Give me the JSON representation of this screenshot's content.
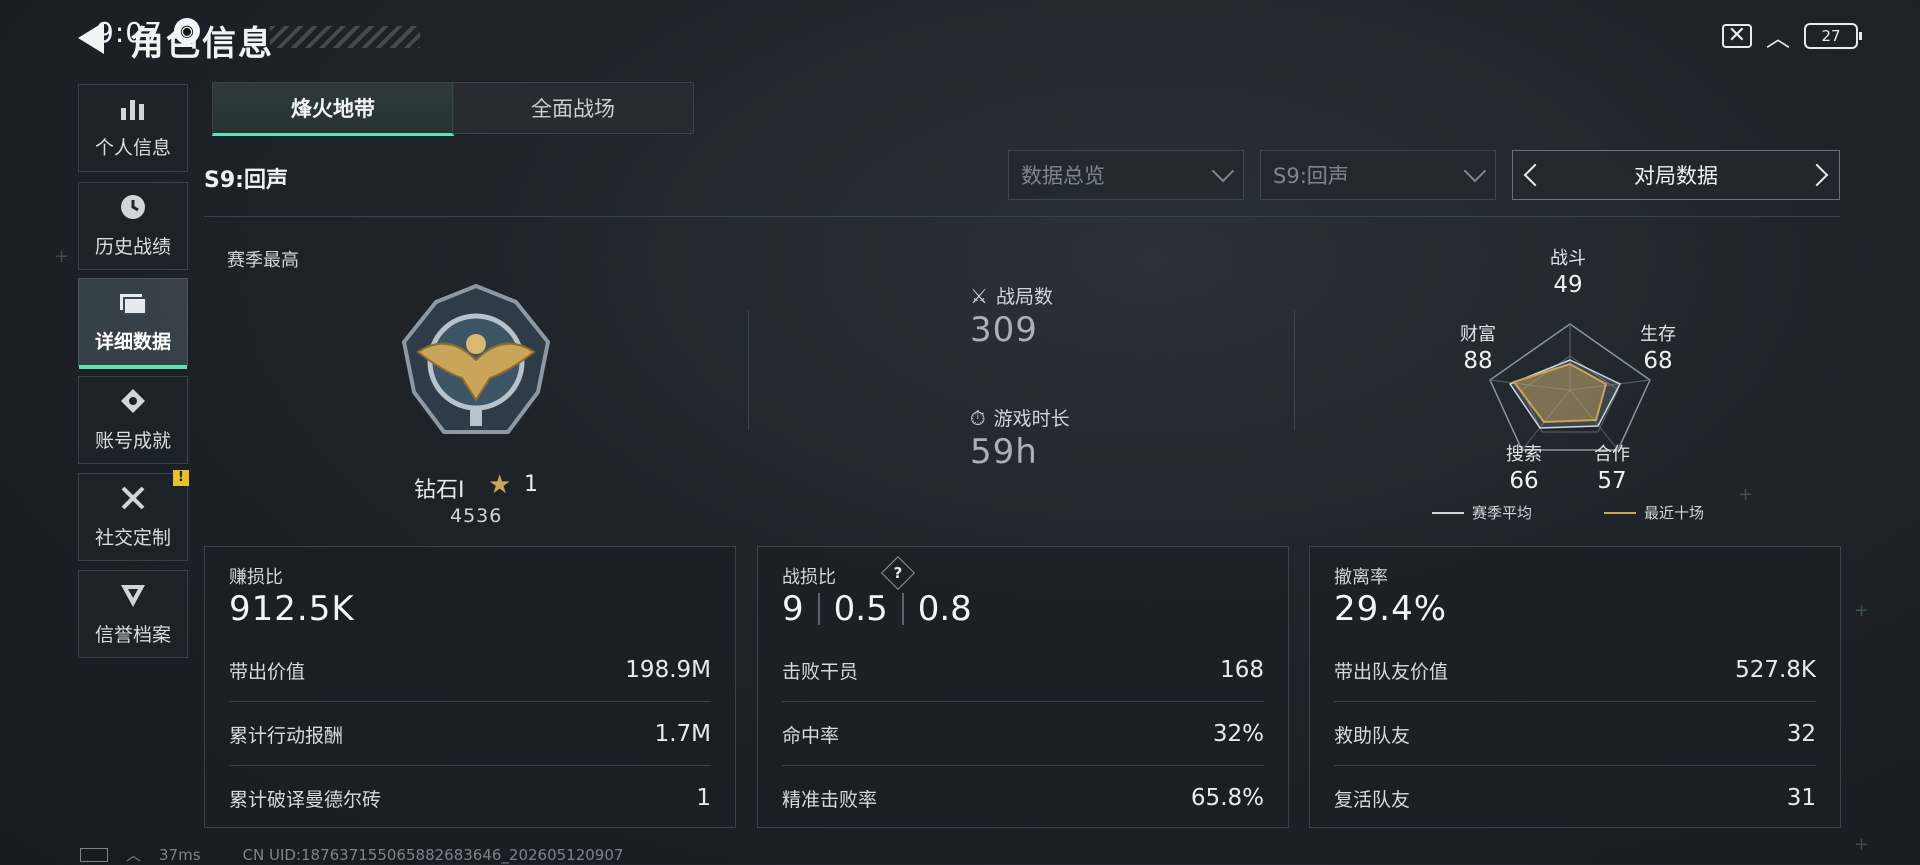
{
  "status_bar": {
    "time": "9:07",
    "app_icon": "qq-icon",
    "battery": "27"
  },
  "header": {
    "title": "角色信息"
  },
  "sidebar": {
    "items": [
      {
        "label": "个人信息",
        "icon": "bar-chart-icon",
        "glyph": "▮"
      },
      {
        "label": "历史战绩",
        "icon": "clock-icon",
        "glyph": "◷"
      },
      {
        "label": "详细数据",
        "icon": "folder-icon",
        "glyph": "▬"
      },
      {
        "label": "账号成就",
        "icon": "achievement-icon",
        "glyph": "◈"
      },
      {
        "label": "社交定制",
        "icon": "tools-icon",
        "glyph": "✕"
      },
      {
        "label": "信誉档案",
        "icon": "shield-icon",
        "glyph": "▼"
      }
    ],
    "badge": "!"
  },
  "tabs": [
    {
      "label": "烽火地带"
    },
    {
      "label": "全面战场"
    }
  ],
  "season": "S9:回声",
  "filters": {
    "overview": "数据总览",
    "season": "S9:回声",
    "pager": "对局数据"
  },
  "summary": {
    "season_best_label": "赛季最高",
    "rank_name": "钻石I",
    "rank_stars": "1",
    "rank_score": "4536",
    "matches_label": "战局数",
    "matches_value": "309",
    "playtime_label": "游戏时长",
    "playtime_value": "59h"
  },
  "radar": {
    "axes": [
      {
        "label": "战斗",
        "value": "49"
      },
      {
        "label": "生存",
        "value": "68"
      },
      {
        "label": "合作",
        "value": "57"
      },
      {
        "label": "搜索",
        "value": "66"
      },
      {
        "label": "财富",
        "value": "88"
      }
    ],
    "legend_avg": "赛季平均",
    "legend_recent": "最近十场",
    "color_avg": "#cfd5db",
    "color_recent": "#c9a55a"
  },
  "panels": {
    "profit": {
      "title": "赚损比",
      "big": "912.5K",
      "rows": [
        {
          "label": "带出价值",
          "value": "198.9M"
        },
        {
          "label": "累计行动报酬",
          "value": "1.7M"
        },
        {
          "label": "累计破译曼德尔砖",
          "value": "1"
        }
      ]
    },
    "combat": {
      "title": "战损比",
      "help": "?",
      "ratio": [
        "9",
        "0.5",
        "0.8"
      ],
      "rows": [
        {
          "label": "击败干员",
          "value": "168"
        },
        {
          "label": "命中率",
          "value": "32%"
        },
        {
          "label": "精准击败率",
          "value": "65.8%"
        }
      ]
    },
    "extract": {
      "title": "撤离率",
      "big": "29.4%",
      "rows": [
        {
          "label": "带出队友价值",
          "value": "527.8K"
        },
        {
          "label": "救助队友",
          "value": "32"
        },
        {
          "label": "复活队友",
          "value": "31"
        }
      ]
    }
  },
  "footer": {
    "ping": "37ms",
    "uid": "CN UID:18763715506588268364​6_202605120907"
  }
}
